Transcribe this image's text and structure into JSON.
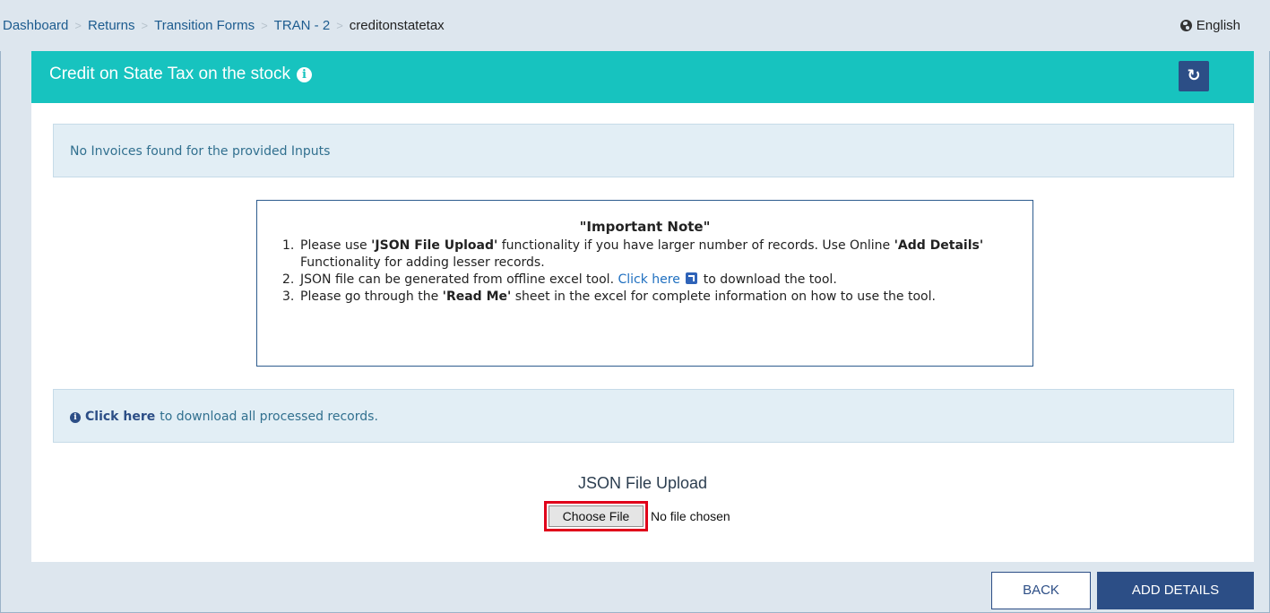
{
  "breadcrumb": {
    "items": [
      "Dashboard",
      "Returns",
      "Transition Forms",
      "TRAN - 2"
    ],
    "current": "creditonstatetax"
  },
  "language": {
    "label": "English",
    "icon": "globe-icon"
  },
  "panel": {
    "title": "Credit on State Tax on the stock",
    "title_icon": "info-icon",
    "refresh_icon": "refresh-icon",
    "header_color": "#17c3bf"
  },
  "alert": {
    "message": "No Invoices found for the provided Inputs"
  },
  "note": {
    "title": "\"Important Note\"",
    "items": [
      {
        "num": "1.",
        "pre": "Please use ",
        "bold1": "'JSON File Upload'",
        "mid": " functionality if you have larger number of records. Use Online ",
        "bold2": "'Add Details'",
        "post": " Functionality for adding lesser records."
      },
      {
        "num": "2.",
        "pre": "JSON file can be generated from offline excel tool. ",
        "link": "Click here",
        "post": " to download the tool."
      },
      {
        "num": "3.",
        "pre": "Please go through the ",
        "bold1": "'Read Me'",
        "post": " sheet in the excel for complete information on how to use the tool."
      }
    ]
  },
  "download": {
    "link": "Click here",
    "text": "to download all processed records."
  },
  "upload": {
    "label": "JSON File Upload",
    "button": "Choose File",
    "status": "No file chosen"
  },
  "actions": {
    "back": "BACK",
    "add": "ADD DETAILS"
  },
  "colors": {
    "primary": "#2c4e86",
    "teal": "#17c3bf",
    "highlight": "#e0001a"
  }
}
